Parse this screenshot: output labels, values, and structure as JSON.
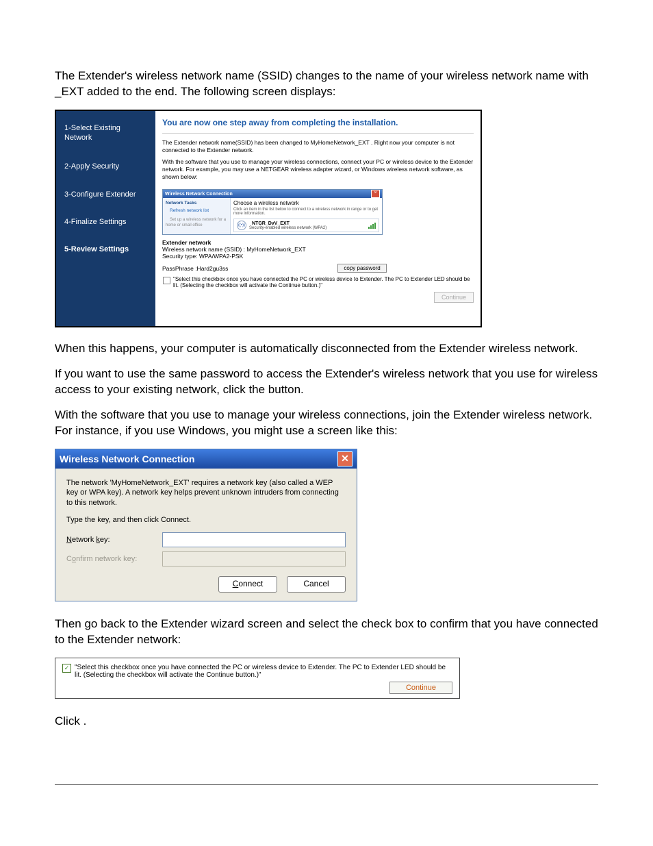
{
  "intro_paragraph": "The Extender's wireless network name (SSID) changes to the name of your wireless network name with _EXT added to the end. The following screen displays:",
  "shot1": {
    "steps": {
      "s1": "1-Select Existing Network",
      "s2": "2-Apply Security",
      "s3": "3-Configure Extender",
      "s4": "4-Finalize Settings",
      "s5": "5-Review Settings"
    },
    "headline": "You are now one step away from completing the installation.",
    "p1": "The Extender network name(SSID) has been changed to MyHomeNetwork_EXT . Right now your computer is not connected to the Extender network.",
    "p2": "With the software that you use to manage your wireless connections, connect your PC or wireless device to the Extender network. For example, you may use a NETGEAR wireless adapter wizard, or Windows wireless network software, as shown below:",
    "wnc": {
      "title": "Wireless Network Connection",
      "side_heading": "Network Tasks",
      "side_refresh": "Refresh network list",
      "side_setup": "Set up a wireless network for a home or small office",
      "main_heading": "Choose a wireless network",
      "main_sub": "Click an item in the list below to connect to a wireless network in range or to get more information.",
      "net_name": "NTGR_DvV_EXT",
      "net_sec": "Security-enabled wireless network (WPA2)"
    },
    "ext_heading": "Extender network",
    "ext_ssid": "Wireless network name (SSID) : MyHomeNetwork_EXT",
    "ext_sectype": "Security type: WPA/WPA2-PSK",
    "passphrase_label": "PassPhrase :Hard2gu3ss",
    "copy_btn": "copy password",
    "cb_text": "\"Select this checkbox once you have connected the PC or wireless device to Extender. The PC to Extender LED should be lit. (Selecting the checkbox will activate the Continue button.)\"",
    "continue": "Continue"
  },
  "mid_p1": "When this happens, your computer is automatically disconnected from the Extender wireless network.",
  "mid_p2a": "If you want to use the same password to access the Extender's wireless network that you use for wireless access to your existing network, click the ",
  "mid_p2b": " button.",
  "mid_p3": "With the software that you use to manage your wireless connections, join the Extender wireless network. For instance, if you use Windows, you might use a screen like this:",
  "shot2": {
    "title": "Wireless Network Connection",
    "p": "The network 'MyHomeNetwork_EXT' requires a network key (also called a WEP key or WPA key). A network key helps prevent unknown intruders from connecting to this network.",
    "instr": "Type the key, and then click Connect.",
    "key_label": "Network key:",
    "confirm_label": "Confirm network key:",
    "connect": "Connect",
    "cancel": "Cancel"
  },
  "after_p": "Then go back to the Extender wizard screen and select the check box to confirm that you have connected to the Extender network:",
  "shot3": {
    "cb_text": "\"Select this checkbox once you have connected the PC or wireless device to Extender. The PC to Extender LED should be lit. (Selecting the checkbox will activate the Continue button.)\"",
    "continue": "Continue"
  },
  "final_a": "Click ",
  "final_b": "."
}
